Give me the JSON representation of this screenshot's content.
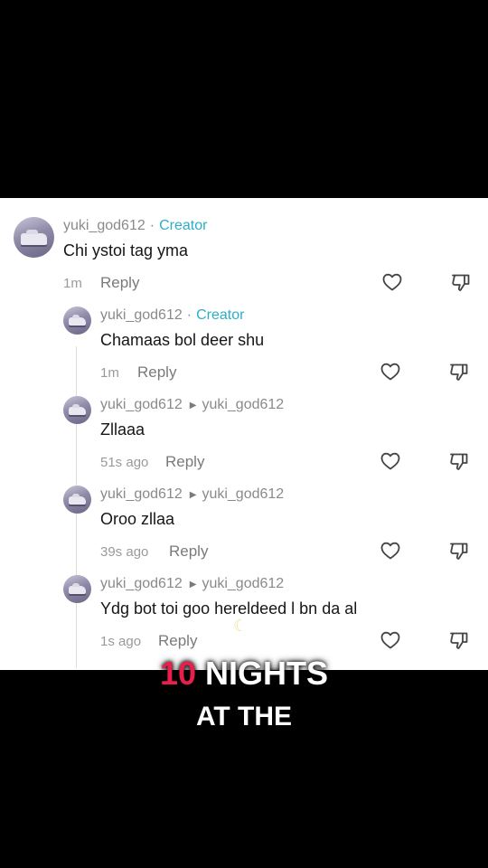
{
  "comments": [
    {
      "username": "yuki_god612",
      "creator_label": "Creator",
      "text": "Chi ystoi tag yma",
      "time": "1m",
      "reply_label": "Reply"
    },
    {
      "username": "yuki_god612",
      "creator_label": "Creator",
      "text": "Chamaas bol deer shu",
      "time": "1m",
      "reply_label": "Reply"
    },
    {
      "username": "yuki_god612",
      "reply_to": "yuki_god612",
      "text": "Zllaaa",
      "time": "51s ago",
      "reply_label": "Reply"
    },
    {
      "username": "yuki_god612",
      "reply_to": "yuki_god612",
      "text": "Oroo zllaa",
      "time": "39s ago",
      "reply_label": "Reply"
    },
    {
      "username": "yuki_god612",
      "reply_to": "yuki_god612",
      "text": "Ydg bot toi goo hereldeed l bn da al",
      "time": "1s ago",
      "reply_label": "Reply"
    }
  ],
  "separator": "·",
  "overlay": {
    "highlight": "10",
    "line1_rest": "NIGHTS",
    "line2": "AT THE"
  },
  "colors": {
    "creator": "#2ab0c6",
    "highlight": "#ea1e4d",
    "panel": "#ffffff",
    "background": "#000000"
  },
  "icons": {
    "like": "heart-outline-icon",
    "dislike": "thumbs-down-outline-icon",
    "reply_arrow": "triangle-right-icon",
    "decor": "crescent-moon-icon"
  }
}
